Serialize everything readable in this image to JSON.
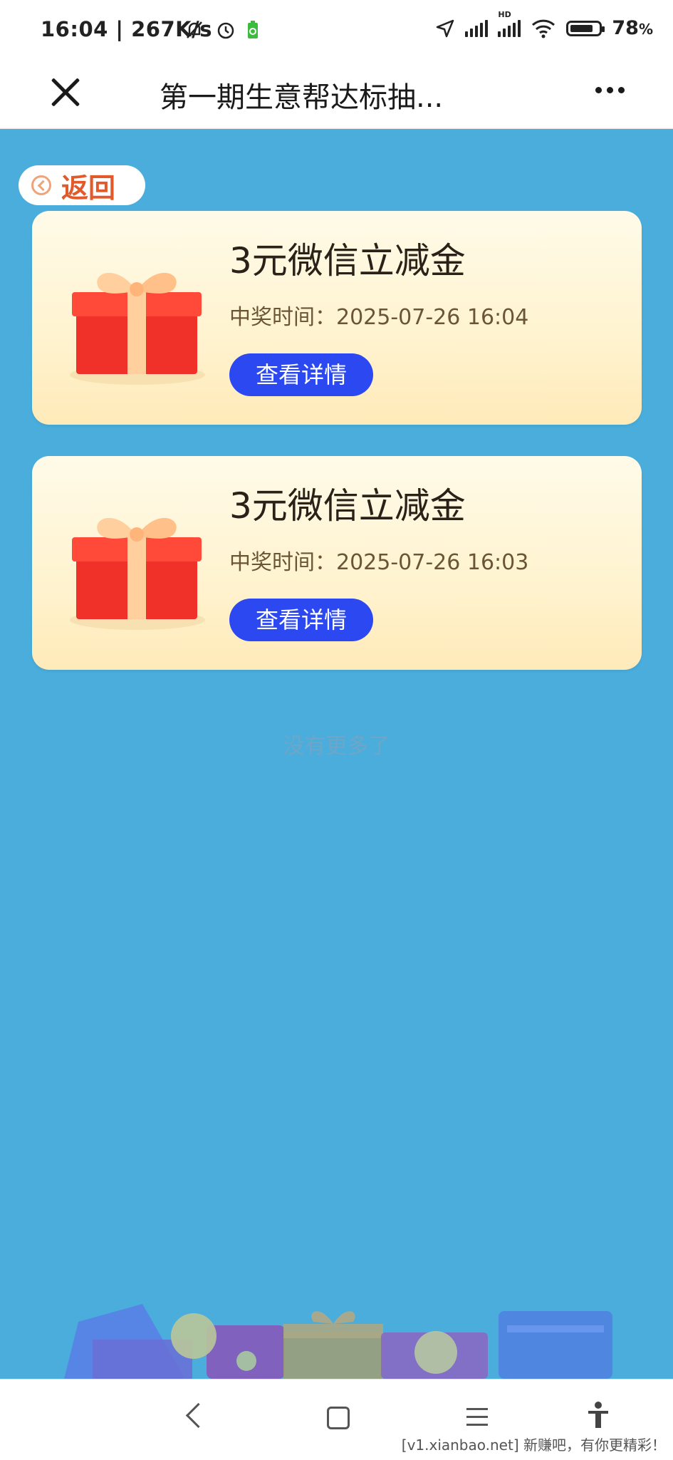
{
  "status_bar": {
    "time_speed": "16:04 | 267K/s",
    "battery_pct": "78",
    "battery_unit": "%",
    "hd_label": "HD",
    "icons": [
      "mute-bell-icon",
      "alarm-icon",
      "battery-saver-icon",
      "location-arrow-icon",
      "signal-icon",
      "hd-signal-icon",
      "wifi-icon",
      "battery-icon"
    ]
  },
  "titlebar": {
    "title": "第一期生意帮达标抽...",
    "icons": [
      "close-icon",
      "more-icon"
    ]
  },
  "back": {
    "label": "返回",
    "icon": "back-circle-icon"
  },
  "cards": [
    {
      "prize": "3元微信立减金",
      "time": "中奖时间：2025-07-26 16:04",
      "button": "查看详情",
      "icon": "gift-box-icon"
    },
    {
      "prize": "3元微信立减金",
      "time": "中奖时间：2025-07-26 16:03",
      "button": "查看详情",
      "icon": "gift-box-icon"
    }
  ],
  "footer_text": "没有更多了",
  "navbar": {
    "icons": [
      "nav-back-icon",
      "nav-home-icon",
      "nav-menu-icon",
      "accessibility-icon"
    ],
    "watermark": "[v1.xianbao.net] 新赚吧，有你更精彩！"
  },
  "colors": {
    "background": "#4aaddc",
    "button": "#2c48f0",
    "back_label": "#e25a2b",
    "card": "#fff3cf",
    "gift_red": "#f0312a"
  }
}
